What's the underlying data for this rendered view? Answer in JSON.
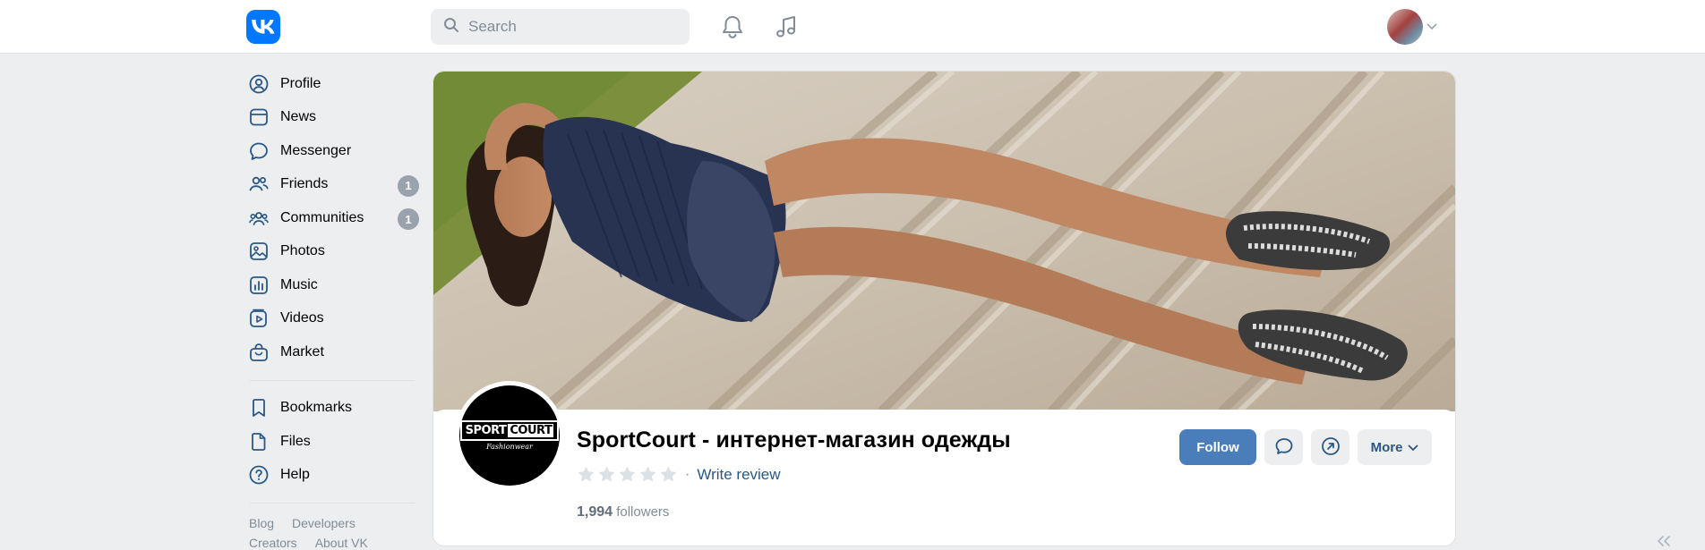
{
  "header": {
    "logo_text": "VK",
    "search_placeholder": "Search"
  },
  "sidebar": {
    "items": [
      {
        "label": "Profile",
        "icon": "user-circle-icon"
      },
      {
        "label": "News",
        "icon": "news-icon"
      },
      {
        "label": "Messenger",
        "icon": "message-icon"
      },
      {
        "label": "Friends",
        "icon": "friends-icon",
        "badge": "1"
      },
      {
        "label": "Communities",
        "icon": "communities-icon",
        "badge": "1"
      },
      {
        "label": "Photos",
        "icon": "photo-icon"
      },
      {
        "label": "Music",
        "icon": "music-icon"
      },
      {
        "label": "Videos",
        "icon": "video-icon"
      },
      {
        "label": "Market",
        "icon": "market-icon"
      }
    ],
    "secondary": [
      {
        "label": "Bookmarks",
        "icon": "bookmark-icon"
      },
      {
        "label": "Files",
        "icon": "file-icon"
      },
      {
        "label": "Help",
        "icon": "help-icon"
      }
    ],
    "footer": [
      "Blog",
      "Developers",
      "Creators",
      "About VK"
    ]
  },
  "group": {
    "logo_left": "SPORT",
    "logo_right": "COURT",
    "logo_script": "Fashionwear",
    "title": "SportCourt - интернет-магазин одежды",
    "rating_stars": 5,
    "separator": "·",
    "write_review": "Write review",
    "followers_count": "1,994",
    "followers_label": "followers",
    "follow_label": "Follow",
    "more_label": "More"
  },
  "colors": {
    "accent": "#4a7ebb",
    "brand": "#0077ff",
    "link": "#2a5885",
    "muted": "#818c99"
  }
}
